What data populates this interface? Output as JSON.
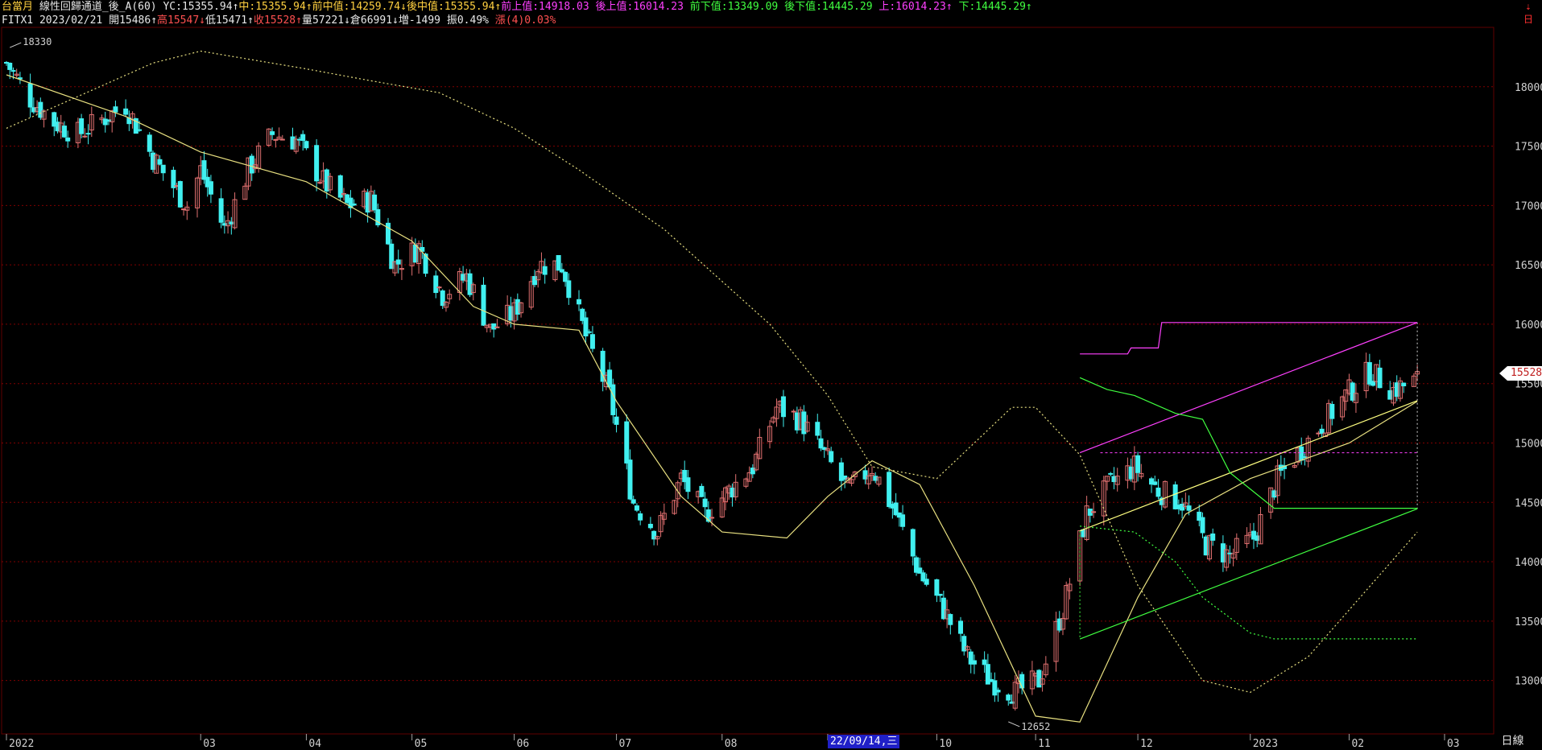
{
  "header": {
    "line1": {
      "chart_name": "台當月",
      "study_name": "線性回歸通道_後_A(60)",
      "yc": "YC:15355.94",
      "yc_arrow": "↑",
      "mid": "中:15355.94",
      "mid_arrow": "↑",
      "front_mid": "前中值:14259.74",
      "front_mid_arrow": "↓",
      "back_mid": "後中值:15355.94",
      "back_mid_arrow": "↑",
      "front_upper": "前上值:14918.03",
      "back_upper": "後上值:16014.23",
      "front_lower": "前下值:13349.09",
      "back_lower": "後下值:14445.29",
      "upper": "上:16014.23",
      "upper_arrow": "↑",
      "lower": "下:14445.29",
      "lower_arrow": "↑"
    },
    "line2": {
      "symbol_date": "FITX1 2023/02/21",
      "open": "開15486",
      "open_arrow": "↑",
      "high": "高15547",
      "high_arrow": "↓",
      "low": "低15471",
      "low_arrow": "↑",
      "close": "收15528",
      "close_arrow": "↑",
      "volume": "量57221",
      "volume_arrow": "↓",
      "open_interest": "倉66991",
      "oi_arrow": "↓",
      "oi_change": "増-1499",
      "amplitude": "振0.49%",
      "change": "漲(4)0.03%"
    }
  },
  "toolbar": {
    "menu_label": "⇣ 日",
    "period_label": "日線"
  },
  "cursor_date": "22/09/14,三",
  "last_price_tag": "15528",
  "colors": {
    "background": "#000000",
    "up_candle": "#e07070",
    "down_candle": "#40f0f0",
    "grid": "#800000",
    "moving_average": "#e8e080",
    "regression_mid": "#ffff80",
    "channel_upper": "#ff40ff",
    "channel_lower": "#40ff40"
  },
  "chart_data": {
    "type": "candlestick",
    "ylim": [
      12550,
      18500
    ],
    "y_ticks": [
      13000,
      13500,
      14000,
      14500,
      15000,
      15500,
      16000,
      16500,
      17000,
      17500,
      18000
    ],
    "x_month_labels": [
      {
        "label": "2022",
        "date": "2022-01-03"
      },
      {
        "label": "03",
        "date": "2022-03-01"
      },
      {
        "label": "04",
        "date": "2022-04-01"
      },
      {
        "label": "05",
        "date": "2022-05-02"
      },
      {
        "label": "06",
        "date": "2022-06-01"
      },
      {
        "label": "07",
        "date": "2022-07-01"
      },
      {
        "label": "08",
        "date": "2022-08-01"
      },
      {
        "label": "09",
        "date": "2022-09-01"
      },
      {
        "label": "10",
        "date": "2022-10-03"
      },
      {
        "label": "11",
        "date": "2022-11-01"
      },
      {
        "label": "12",
        "date": "2022-12-01"
      },
      {
        "label": "2023",
        "date": "2023-01-03"
      },
      {
        "label": "02",
        "date": "2023-02-01"
      },
      {
        "label": "03",
        "date": "2023-03-01"
      }
    ],
    "annotations": {
      "high_label": "18330",
      "low_label": "12652",
      "last_close": 15528
    },
    "close_path": [
      [
        "2022-01-03",
        18200
      ],
      [
        "2022-01-10",
        17900
      ],
      [
        "2022-01-17",
        17700
      ],
      [
        "2022-01-24",
        17600
      ],
      [
        "2022-02-07",
        17850
      ],
      [
        "2022-02-15",
        17400
      ],
      [
        "2022-02-25",
        17000
      ],
      [
        "2022-03-01",
        17300
      ],
      [
        "2022-03-08",
        16800
      ],
      [
        "2022-03-15",
        17300
      ],
      [
        "2022-03-22",
        17600
      ],
      [
        "2022-03-29",
        17550
      ],
      [
        "2022-04-06",
        17200
      ],
      [
        "2022-04-13",
        17000
      ],
      [
        "2022-04-20",
        17050
      ],
      [
        "2022-04-27",
        16500
      ],
      [
        "2022-05-04",
        16650
      ],
      [
        "2022-05-11",
        16250
      ],
      [
        "2022-05-18",
        16400
      ],
      [
        "2022-05-25",
        15950
      ],
      [
        "2022-06-01",
        16100
      ],
      [
        "2022-06-08",
        16500
      ],
      [
        "2022-06-15",
        16500
      ],
      [
        "2022-06-22",
        15900
      ],
      [
        "2022-06-29",
        15400
      ],
      [
        "2022-07-06",
        14500
      ],
      [
        "2022-07-13",
        14250
      ],
      [
        "2022-07-20",
        14700
      ],
      [
        "2022-07-27",
        14400
      ],
      [
        "2022-08-03",
        14600
      ],
      [
        "2022-08-10",
        14800
      ],
      [
        "2022-08-17",
        15300
      ],
      [
        "2022-08-24",
        15200
      ],
      [
        "2022-08-31",
        14900
      ],
      [
        "2022-09-07",
        14600
      ],
      [
        "2022-09-14",
        14800
      ],
      [
        "2022-09-21",
        14400
      ],
      [
        "2022-09-28",
        13900
      ],
      [
        "2022-10-05",
        13600
      ],
      [
        "2022-10-12",
        13200
      ],
      [
        "2022-10-19",
        13000
      ],
      [
        "2022-10-26",
        12900
      ],
      [
        "2022-11-02",
        13000
      ],
      [
        "2022-11-09",
        13600
      ],
      [
        "2022-11-16",
        14400
      ],
      [
        "2022-11-23",
        14650
      ],
      [
        "2022-11-30",
        14800
      ],
      [
        "2022-12-07",
        14600
      ],
      [
        "2022-12-14",
        14500
      ],
      [
        "2022-12-21",
        14150
      ],
      [
        "2022-12-28",
        14050
      ],
      [
        "2023-01-04",
        14200
      ],
      [
        "2023-01-11",
        14700
      ],
      [
        "2023-01-18",
        14950
      ],
      [
        "2023-01-31",
        15400
      ],
      [
        "2023-02-07",
        15600
      ],
      [
        "2023-02-14",
        15450
      ],
      [
        "2023-02-21",
        15528
      ]
    ],
    "moving_average": [
      [
        "2022-01-03",
        18100
      ],
      [
        "2022-02-07",
        17750
      ],
      [
        "2022-03-01",
        17450
      ],
      [
        "2022-04-01",
        17200
      ],
      [
        "2022-05-02",
        16700
      ],
      [
        "2022-05-20",
        16150
      ],
      [
        "2022-06-01",
        16000
      ],
      [
        "2022-06-20",
        15950
      ],
      [
        "2022-07-01",
        15350
      ],
      [
        "2022-07-20",
        14550
      ],
      [
        "2022-08-01",
        14250
      ],
      [
        "2022-08-20",
        14200
      ],
      [
        "2022-09-01",
        14550
      ],
      [
        "2022-09-14",
        14850
      ],
      [
        "2022-09-28",
        14650
      ],
      [
        "2022-10-14",
        13800
      ],
      [
        "2022-11-01",
        12700
      ],
      [
        "2022-11-14",
        12650
      ],
      [
        "2022-12-01",
        13700
      ],
      [
        "2022-12-15",
        14400
      ],
      [
        "2023-01-03",
        14700
      ],
      [
        "2023-02-01",
        15000
      ],
      [
        "2023-02-21",
        15350
      ]
    ],
    "long_average_dotted": [
      [
        "2022-01-03",
        17650
      ],
      [
        "2022-02-15",
        18200
      ],
      [
        "2022-03-01",
        18300
      ],
      [
        "2022-04-01",
        18150
      ],
      [
        "2022-04-20",
        18050
      ],
      [
        "2022-05-10",
        17950
      ],
      [
        "2022-06-01",
        17650
      ],
      [
        "2022-06-20",
        17300
      ],
      [
        "2022-07-15",
        16800
      ],
      [
        "2022-08-15",
        16000
      ],
      [
        "2022-09-01",
        15400
      ],
      [
        "2022-09-14",
        14800
      ],
      [
        "2022-10-03",
        14700
      ],
      [
        "2022-10-25",
        15300
      ],
      [
        "2022-11-01",
        15300
      ],
      [
        "2022-11-14",
        14900
      ],
      [
        "2022-12-01",
        13800
      ],
      [
        "2022-12-20",
        13000
      ],
      [
        "2023-01-03",
        12900
      ],
      [
        "2023-01-20",
        13200
      ],
      [
        "2023-02-21",
        14250
      ]
    ],
    "regression_channel": {
      "start": "2022-11-14",
      "end": "2023-02-21",
      "front_mid": 14259.74,
      "back_mid": 15355.94,
      "front_upper": 14918.03,
      "back_upper": 16014.23,
      "front_lower": 13349.09,
      "back_lower": 14445.29
    },
    "upper_step_line": [
      [
        "2022-11-14",
        15750
      ],
      [
        "2022-11-28",
        15750
      ],
      [
        "2022-11-29",
        15800
      ],
      [
        "2022-12-07",
        15800
      ],
      [
        "2022-12-08",
        16014
      ],
      [
        "2023-02-21",
        16014
      ]
    ],
    "lower_step_line": [
      [
        "2022-11-14",
        15550
      ],
      [
        "2022-11-22",
        15450
      ],
      [
        "2022-11-30",
        15400
      ],
      [
        "2022-12-12",
        15250
      ],
      [
        "2022-12-20",
        15200
      ],
      [
        "2022-12-28",
        14750
      ],
      [
        "2023-01-10",
        14450
      ],
      [
        "2023-02-21",
        14450
      ]
    ],
    "dotted_support_line": [
      [
        "2022-11-14",
        14300
      ],
      [
        "2022-11-30",
        14250
      ],
      [
        "2022-12-12",
        14000
      ],
      [
        "2022-12-20",
        13700
      ],
      [
        "2023-01-03",
        13400
      ],
      [
        "2023-01-10",
        13350
      ],
      [
        "2023-02-21",
        13350
      ]
    ]
  }
}
